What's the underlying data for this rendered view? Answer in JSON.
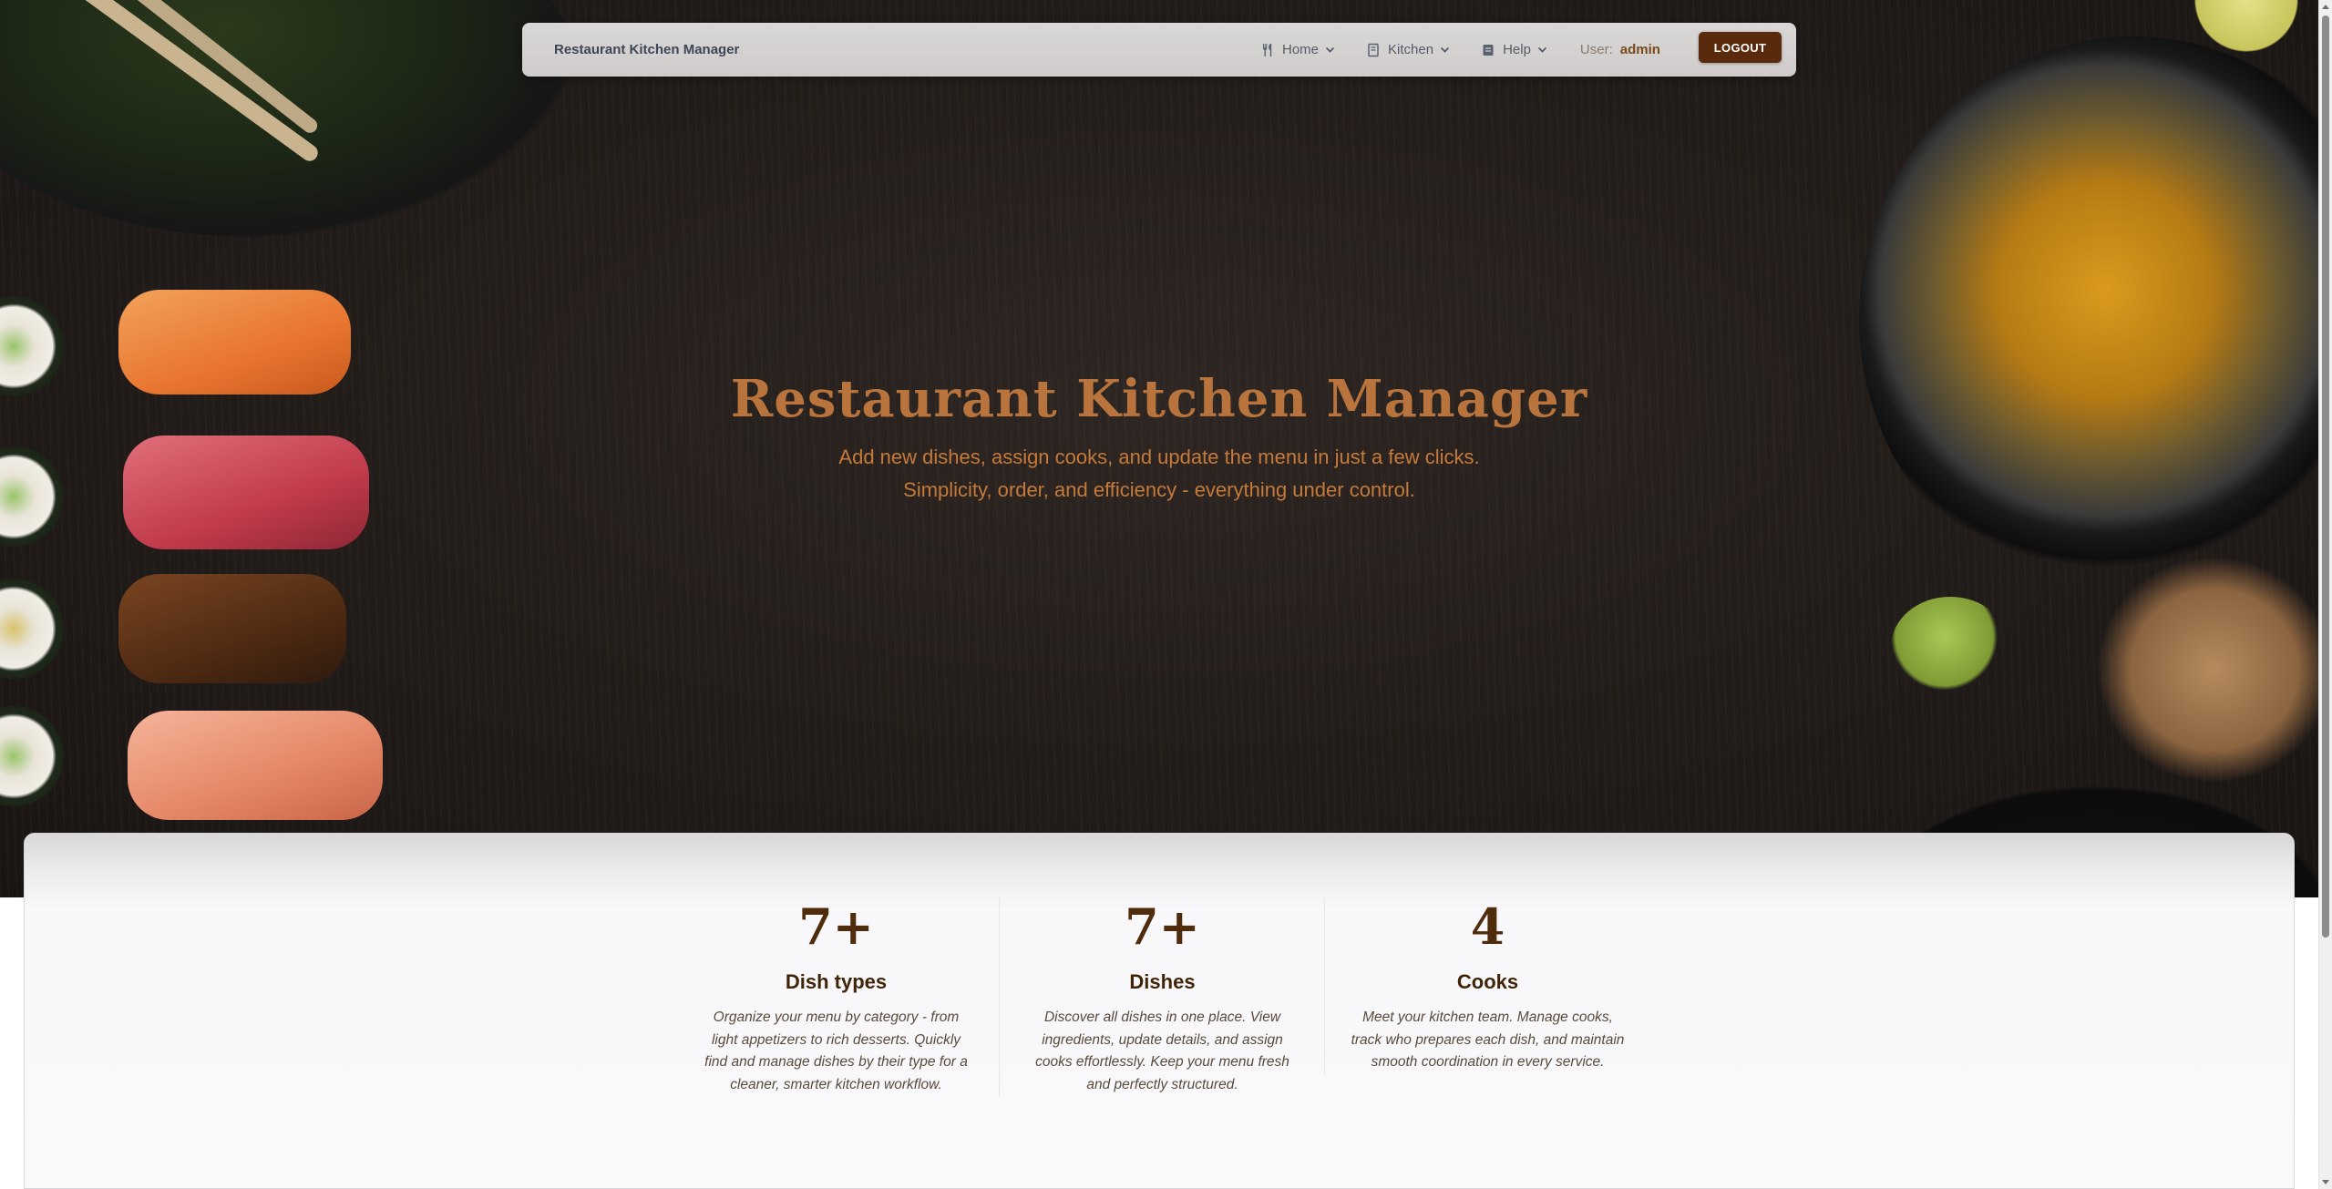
{
  "navbar": {
    "brand": "Restaurant Kitchen Manager",
    "items": [
      {
        "label": "Home",
        "icon": "utensils-icon"
      },
      {
        "label": "Kitchen",
        "icon": "book-icon"
      },
      {
        "label": "Help",
        "icon": "help-book-icon"
      }
    ],
    "user_label": "User:",
    "user_name": "admin",
    "logout_label": "LOGOUT"
  },
  "hero": {
    "title": "Restaurant Kitchen Manager",
    "subtitle_line1": "Add new dishes, assign cooks, and update the menu in just a few clicks.",
    "subtitle_line2": "Simplicity, order, and efficiency - everything under control."
  },
  "stats": [
    {
      "number": "7+",
      "title": "Dish types",
      "description": "Organize your menu by category - from light appetizers to rich desserts. Quickly find and manage dishes by their type for a cleaner, smarter kitchen workflow."
    },
    {
      "number": "7+",
      "title": "Dishes",
      "description": "Discover all dishes in one place. View ingredients, update details, and assign cooks effortlessly. Keep your menu fresh and perfectly structured."
    },
    {
      "number": "4",
      "title": "Cooks",
      "description": "Meet your kitchen team. Manage cooks, track who prepares each dish, and maintain smooth coordination in every service."
    }
  ],
  "colors": {
    "accent": "#5a2a0c",
    "hero_title": "#b8743c",
    "hero_subtitle": "#c57a3a",
    "stat_number": "#4e2c0c"
  }
}
